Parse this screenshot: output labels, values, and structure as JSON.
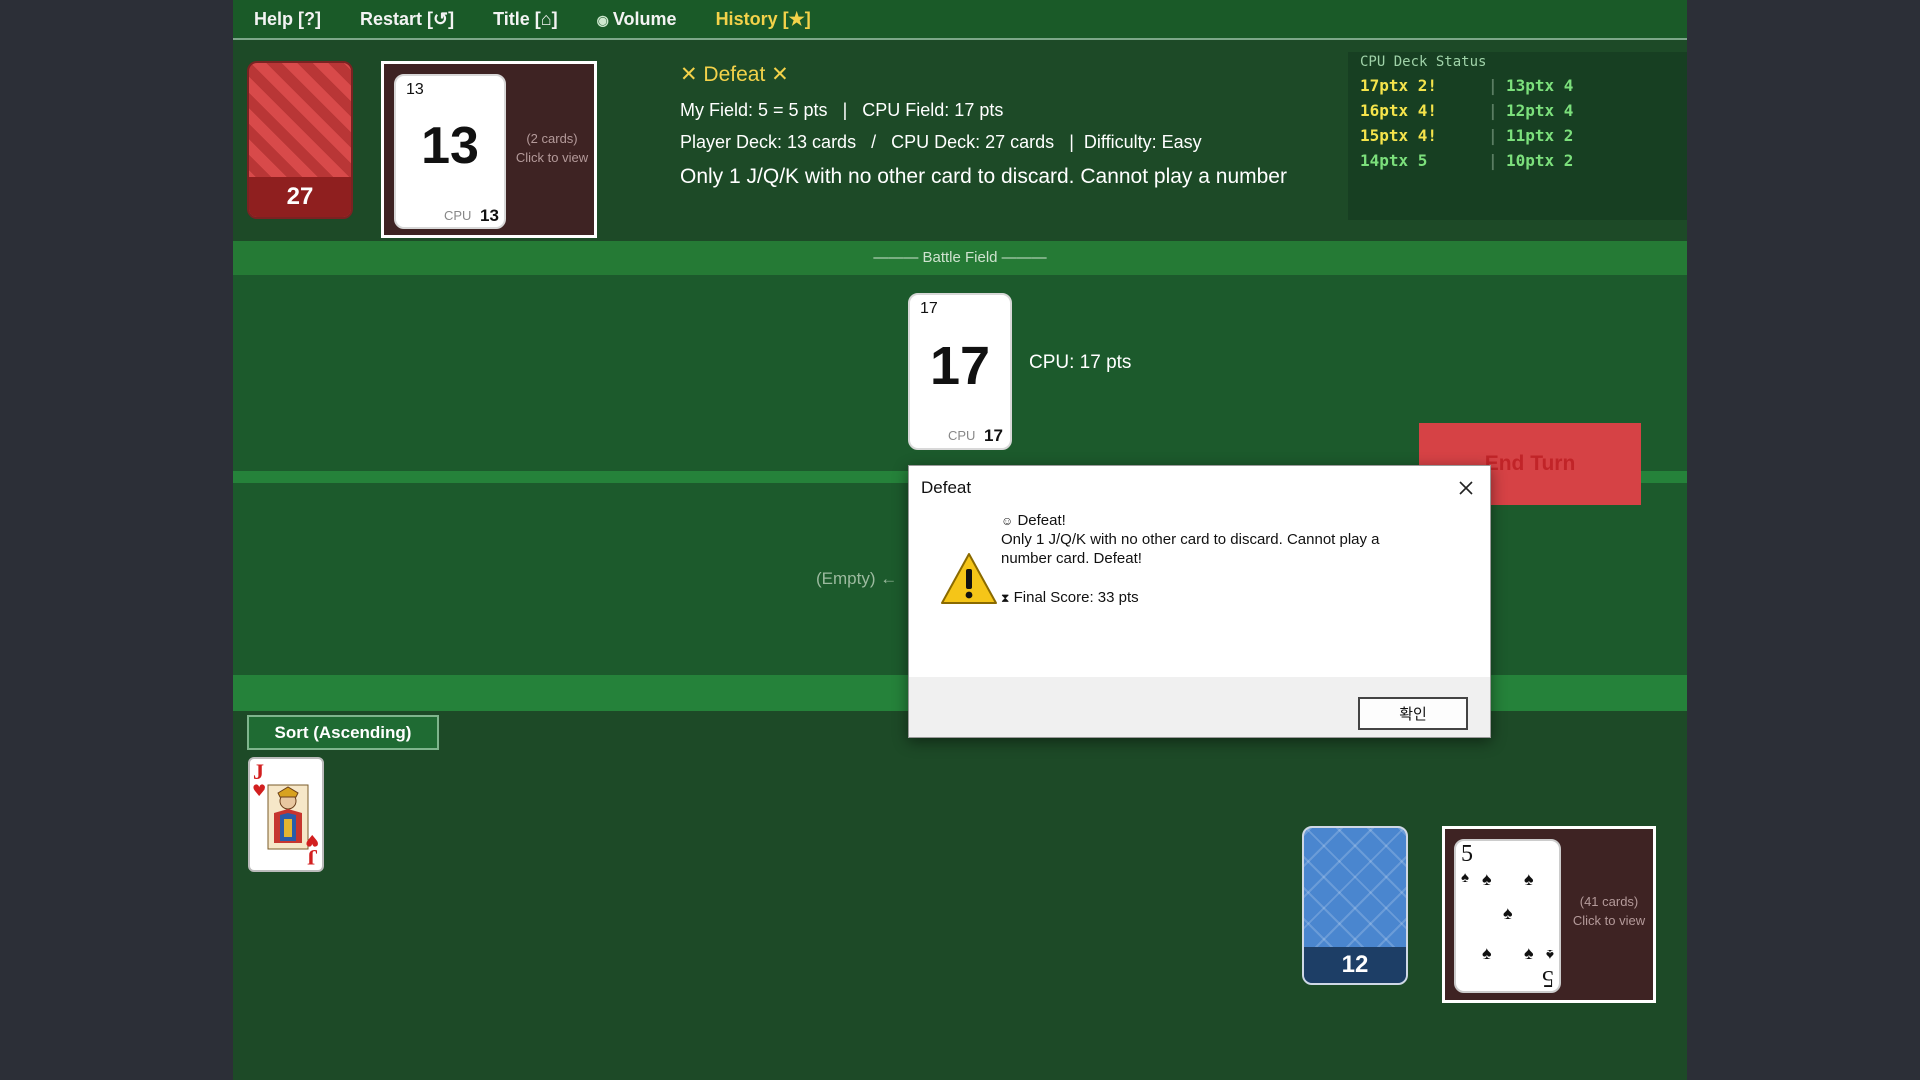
{
  "menu": {
    "help": "Help [?]",
    "restart": "Restart [↺]",
    "title": "Title [⌂]",
    "volume": "Volume",
    "history": "History [★]"
  },
  "cpu": {
    "deck_count": "27",
    "discard": {
      "card_corner": "13",
      "card_value": "13",
      "card_tag": "CPU",
      "card_small": "13",
      "count_note": "(2 cards)",
      "click_note": "Click to view"
    }
  },
  "status": {
    "title": "✕ Defeat ✕",
    "my_field": "My Field: 5 = 5 pts",
    "sep1": "|",
    "cpu_field": "CPU Field: 17 pts",
    "player_deck": "Player Deck: 13 cards",
    "slash": "/",
    "cpu_deck": "CPU Deck: 27 cards",
    "sep2": "|",
    "difficulty": "Difficulty: Easy",
    "message": "Only 1 J/Q/K with no other card to discard. Cannot play a number"
  },
  "cpu_deck_status": {
    "header": "CPU Deck Status",
    "rows": [
      {
        "left": "17ptx 2!",
        "right": "13ptx 4"
      },
      {
        "left": "16ptx 4!",
        "right": "12ptx 4"
      },
      {
        "left": "15ptx 4!",
        "right": "11ptx 2"
      },
      {
        "left": "14ptx 5",
        "right": "10ptx 2"
      }
    ]
  },
  "battlefield": {
    "header": "——— Battle Field ———",
    "cpu_card": {
      "corner": "17",
      "value": "17",
      "tag": "CPU",
      "small": "17"
    },
    "cpu_label": "CPU: 17 pts",
    "player_empty": "(Empty) ←"
  },
  "end_turn": "End Turn",
  "player": {
    "sort_label": "Sort (Ascending)",
    "hand": [
      {
        "rank": "J",
        "suit": "hearts"
      }
    ],
    "deck_count": "12",
    "discard": {
      "top_rank": "5",
      "top_suit": "spades",
      "count_note": "(41 cards)",
      "click_note": "Click to view"
    }
  },
  "dialog": {
    "title": "Defeat",
    "line1": "Defeat!",
    "line2": "Only 1 J/Q/K with no other card to discard. Cannot play a",
    "line3": "number card. Defeat!",
    "score": "Final Score: 33 pts",
    "ok": "확인"
  },
  "colors": {
    "table_green": "#1d4a27",
    "battle_green": "#1c5a2c",
    "band_green": "#25823a",
    "accent_gold": "#f3d24a",
    "end_turn_red": "#d64245",
    "cpu_deck_red": "#d84a4a",
    "player_deck_blue": "#4a86cf"
  }
}
